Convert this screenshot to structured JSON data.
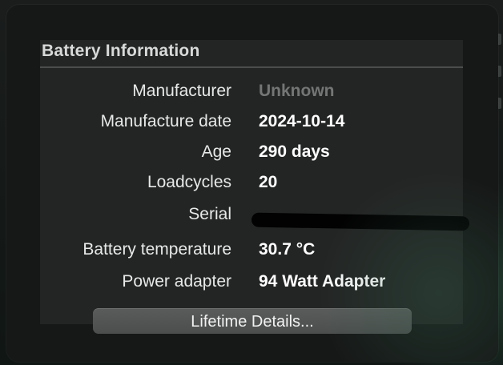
{
  "panel": {
    "title": "Battery Information"
  },
  "rows": [
    {
      "label": "Manufacturer",
      "value": "Unknown"
    },
    {
      "label": "Manufacture date",
      "value": "2024-10-14"
    },
    {
      "label": "Age",
      "value": "290 days"
    },
    {
      "label": "Loadcycles",
      "value": "20"
    },
    {
      "label": "Serial",
      "value": ""
    },
    {
      "label": "Battery temperature",
      "value": "30.7 °C"
    },
    {
      "label": "Power adapter",
      "value": "94 Watt Adapter"
    }
  ],
  "buttons": {
    "lifetime_details": "Lifetime Details..."
  },
  "colors": {
    "panel_background": "#232524",
    "label_text": "#e7e8e8",
    "value_text": "#ffffff",
    "muted_value": "#747675",
    "button_background": "#555857"
  }
}
